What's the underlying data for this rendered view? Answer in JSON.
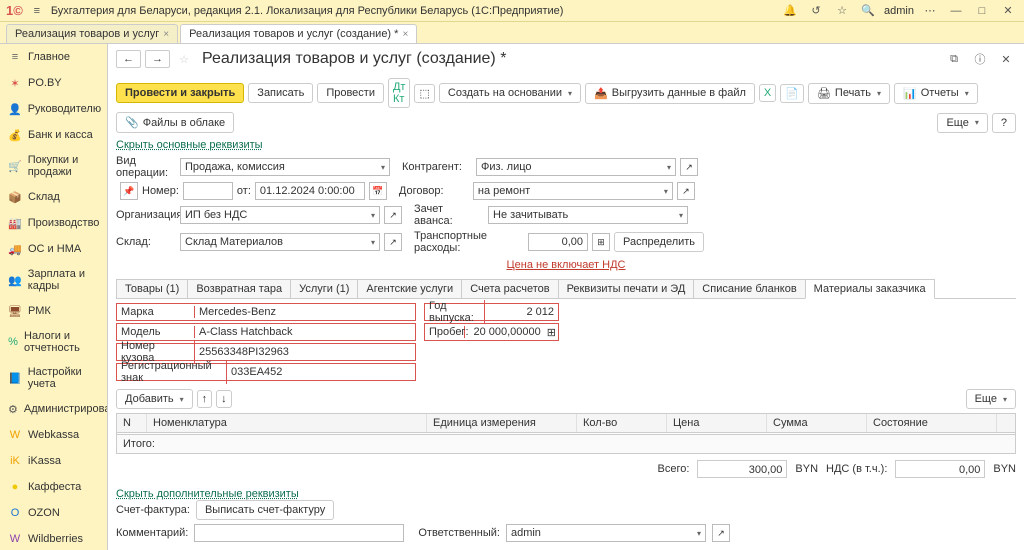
{
  "titlebar": {
    "app": "Бухгалтерия для Беларуси, редакция 2.1. Локализация для Республики Беларусь  (1С:Предприятие)",
    "user": "admin"
  },
  "windowTabs": [
    {
      "label": "Реализация товаров и услуг"
    },
    {
      "label": "Реализация товаров и услуг (создание) *"
    }
  ],
  "sidebar": [
    {
      "icon": "≡",
      "label": "Главное",
      "color": "#666"
    },
    {
      "icon": "✶",
      "label": "PO.BY",
      "color": "#d9534f"
    },
    {
      "icon": "👤",
      "label": "Руководителю",
      "color": "#d9534f"
    },
    {
      "icon": "💰",
      "label": "Банк и касса",
      "color": "#d9a400"
    },
    {
      "icon": "🛒",
      "label": "Покупки и продажи",
      "color": "#c0392b"
    },
    {
      "icon": "📦",
      "label": "Склад",
      "color": "#8b4a2b"
    },
    {
      "icon": "🏭",
      "label": "Производство",
      "color": "#555"
    },
    {
      "icon": "🚚",
      "label": "ОС и НМА",
      "color": "#555"
    },
    {
      "icon": "👥",
      "label": "Зарплата и кадры",
      "color": "#2a7"
    },
    {
      "icon": "🖥",
      "label": "РМК",
      "color": "#8b4a2b"
    },
    {
      "icon": "%",
      "label": "Налоги и отчетность",
      "color": "#2a7"
    },
    {
      "icon": "📘",
      "label": "Настройки учета",
      "color": "#8b4a2b"
    },
    {
      "icon": "⚙",
      "label": "Администрирование",
      "color": "#555"
    },
    {
      "icon": "W",
      "label": "Webkassa",
      "color": "#f0a000"
    },
    {
      "icon": "iK",
      "label": "iKassa",
      "color": "#f0a000"
    },
    {
      "icon": "●",
      "label": "Каффеста",
      "color": "#f0c800"
    },
    {
      "icon": "O",
      "label": "OZON",
      "color": "#1976d2"
    },
    {
      "icon": "W",
      "label": "Wildberries",
      "color": "#8e44ad"
    }
  ],
  "doc": {
    "title": "Реализация товаров и услуг (создание) *"
  },
  "toolbar": {
    "post_close": "Провести и закрыть",
    "write": "Записать",
    "post": "Провести",
    "create_based": "Создать на основании",
    "export": "Выгрузить данные в файл",
    "print": "Печать",
    "reports": "Отчеты",
    "files": "Файлы в облаке",
    "more": "Еще",
    "help": "?"
  },
  "links": {
    "hide_main": "Скрыть основные реквизиты",
    "hide_extra": "Скрыть дополнительные реквизиты",
    "vat": "Цена не включает НДС"
  },
  "form": {
    "vid_op_l": "Вид операции:",
    "vid_op_v": "Продажа, комиссия",
    "num_l": "Номер:",
    "ot": "от:",
    "date": "01.12.2024 0:00:00",
    "org_l": "Организация:",
    "org_v": "ИП без НДС",
    "sklad_l": "Склад:",
    "sklad_v": "Склад Материалов",
    "ka_l": "Контрагент:",
    "ka_v": "Физ. лицо",
    "dog_l": "Договор:",
    "dog_v": "на ремонт",
    "zav_l": "Зачет аванса:",
    "zav_v": "Не зачитывать",
    "tr_l": "Транспортные расходы:",
    "tr_v": "0,00",
    "distribute": "Распределить"
  },
  "tabs": [
    "Товары (1)",
    "Возвратная тара",
    "Услуги (1)",
    "Агентские услуги",
    "Счета расчетов",
    "Реквизиты печати и ЭД",
    "Списание бланков",
    "Материалы заказчика"
  ],
  "activeTab": 7,
  "red": {
    "marka_l": "Марка",
    "marka_v": "Mercedes-Benz",
    "model_l": "Модель",
    "model_v": "A-Class Hatchback",
    "kuzov_l": "Номер кузова",
    "kuzov_v": "25563348PI32963",
    "reg_l": "Регистрационный знак",
    "reg_v": "033EA452",
    "god_l": "Год выпуска:",
    "god_v": "2 012",
    "probeg_l": "Пробег:",
    "probeg_v": "20 000,00000"
  },
  "tableTools": {
    "add": "Добавить",
    "more": "Еще"
  },
  "grid": {
    "cols": [
      "N",
      "Номенклатура",
      "Единица измерения",
      "Кол-во",
      "Цена",
      "Сумма",
      "Состояние"
    ],
    "footer": "Итого:"
  },
  "totals": {
    "vsego_l": "Всего:",
    "vsego_v": "300,00",
    "cur1": "BYN",
    "nds_l": "НДС (в т.ч.):",
    "nds_v": "0,00",
    "cur2": "BYN"
  },
  "footer": {
    "sf_l": "Счет-фактура:",
    "sf_btn": "Выписать счет-фактуру",
    "comment_l": "Комментарий:",
    "resp_l": "Ответственный:",
    "resp_v": "admin"
  }
}
